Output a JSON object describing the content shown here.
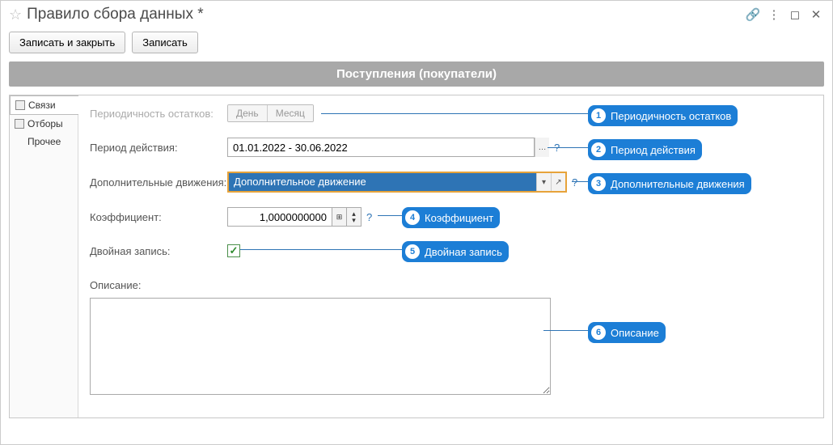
{
  "titlebar": {
    "title": "Правило сбора данных *"
  },
  "toolbar": {
    "save_close": "Записать и закрыть",
    "save": "Записать"
  },
  "section": "Поступления (покупатели)",
  "sidebar": {
    "items": [
      {
        "label": "Связи"
      },
      {
        "label": "Отборы"
      },
      {
        "label": "Прочее"
      }
    ]
  },
  "form": {
    "periodicity_label": "Периодичность остатков:",
    "periodicity_day": "День",
    "periodicity_month": "Месяц",
    "period_label": "Период действия:",
    "period_value": "01.01.2022 - 30.06.2022",
    "addmove_label": "Дополнительные движения:",
    "addmove_value": "Дополнительное движение",
    "coef_label": "Коэффициент:",
    "coef_value": "1,0000000000",
    "double_label": "Двойная запись:",
    "desc_label": "Описание:"
  },
  "callouts": {
    "c1": "Периодичность остатков",
    "c2": "Период действия",
    "c3": "Дополнительные движения",
    "c4": "Коэффициент",
    "c5": "Двойная запись",
    "c6": "Описание"
  }
}
